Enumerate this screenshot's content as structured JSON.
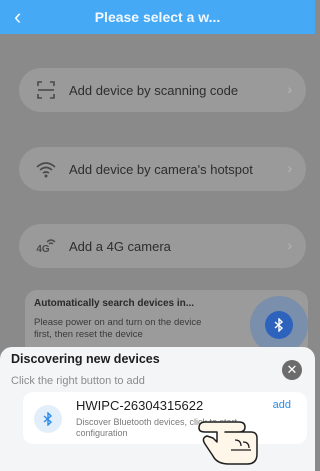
{
  "header": {
    "title": "Please select a w..."
  },
  "options": [
    {
      "label": "Add device by scanning code",
      "icon": "scan-icon"
    },
    {
      "label": "Add device by camera's hotspot",
      "icon": "wifi-icon"
    },
    {
      "label": "Add a 4G camera",
      "icon": "4g-icon",
      "icon_text": "4G"
    }
  ],
  "auto_search": {
    "title": "Automatically search devices in...",
    "description": "Please power on and turn on the device first, then reset the device"
  },
  "sheet": {
    "title": "Discovering new devices",
    "subtitle": "Click the right button to add"
  },
  "device": {
    "name": "HWIPC-26304315622",
    "action": "add",
    "description": "Discover Bluetooth devices, click to start configuration"
  },
  "colors": {
    "header_blue": "#45a9f6",
    "accent_blue": "#2c8be6"
  }
}
